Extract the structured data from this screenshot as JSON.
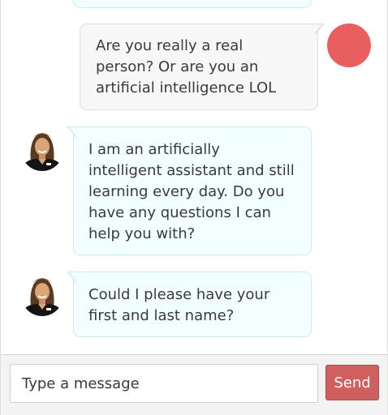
{
  "colors": {
    "user_avatar": "#e95e5e",
    "send_button": "#d06060"
  },
  "conversation": {
    "messages": [
      {
        "sender": "bot",
        "text": ""
      },
      {
        "sender": "user",
        "text": "Are you really a real person? Or are you an artificial intelligence LOL"
      },
      {
        "sender": "bot",
        "text": "I am an artificially intelligent assistant and still learning every day. Do you have any questions I can help you with?"
      },
      {
        "sender": "bot",
        "text": "Could I please have your first and last name?"
      }
    ]
  },
  "composer": {
    "placeholder": "Type a message",
    "send_label": "Send"
  }
}
